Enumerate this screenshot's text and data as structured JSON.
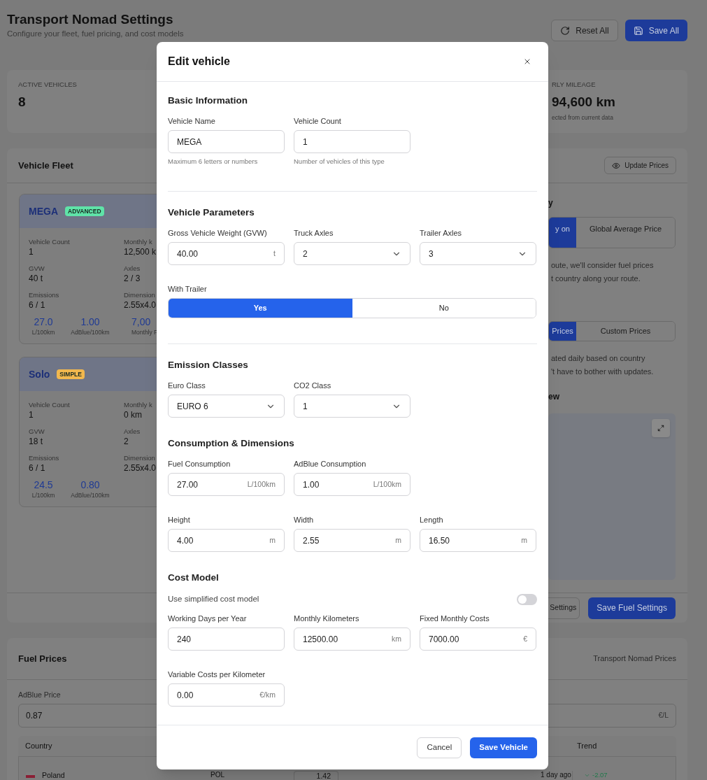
{
  "header": {
    "title": "Transport Nomad Settings",
    "subtitle": "Configure your fleet, fuel pricing, and cost models",
    "buttons": [
      {
        "label": "Reset All",
        "kind": "secondary"
      },
      {
        "label": "Save All",
        "kind": "primary"
      }
    ]
  },
  "stats": {
    "left": {
      "label": "ACTIVE VEHICLES",
      "value": "8"
    },
    "right": {
      "label": "RLY MILEAGE",
      "value": "94,600 km",
      "note": "ected from current data"
    }
  },
  "vehicle_fleet": {
    "title": "Vehicle Fleet",
    "action": "Update Prices",
    "vehicles": [
      {
        "name": "MEGA",
        "badge": "ADVANCED",
        "color": "#5fe3a8",
        "fields": [
          {
            "label": "Vehicle Count",
            "value": "1"
          },
          {
            "label": "Monthly k",
            "value": "12,500 k"
          },
          {
            "label": "GVW",
            "value": "40 t"
          },
          {
            "label": "Axles",
            "value": "2 / 3"
          },
          {
            "label": "Emissions",
            "value": "6 / 1"
          },
          {
            "label": "Dimension",
            "value": "2.55x4.0"
          }
        ],
        "metrics": [
          {
            "value": "27.0",
            "label": "L/100km"
          },
          {
            "value": "1.00",
            "label": "AdBlue/100km"
          },
          {
            "value": "7,00",
            "label": "Monthly F"
          }
        ]
      },
      {
        "name": "Solo",
        "badge": "SIMPLE",
        "color": "#f2b84e",
        "fields": [
          {
            "label": "Vehicle Count",
            "value": "1"
          },
          {
            "label": "Monthly k",
            "value": "0 km"
          },
          {
            "label": "GVW",
            "value": "18 t"
          },
          {
            "label": "Axles",
            "value": "2"
          },
          {
            "label": "Emissions",
            "value": "6 / 1"
          },
          {
            "label": "Dimension",
            "value": "2.55x4.0"
          }
        ],
        "metrics": [
          {
            "value": "24.5",
            "label": "L/100km"
          },
          {
            "value": "0.80",
            "label": "AdBlue/100km"
          }
        ]
      }
    ],
    "fuel_strategy": {
      "title": "y",
      "options": [
        {
          "label": "y on",
          "selected": true
        },
        {
          "label": "Global Average Price",
          "selected": false
        }
      ],
      "note": "oute, we'll consider fuel prices\nt country along your route.",
      "price_options": [
        {
          "label": "Prices",
          "selected": true
        },
        {
          "label": "Custom Prices",
          "selected": false
        }
      ],
      "price_note": "ated daily based on country\n't have to bother with updates.",
      "map_title": "ew"
    },
    "footer_buttons": [
      {
        "label": "Settings",
        "kind": "secondary"
      },
      {
        "label": "Save Fuel Settings",
        "kind": "primary"
      }
    ]
  },
  "fuel_prices": {
    "title": "Fuel Prices",
    "source": "Transport Nomad Prices",
    "adblue_label": "AdBlue Price",
    "adblue_value": "0.87",
    "adblue_unit": "€/L",
    "table": {
      "columns": [
        "Country",
        "Trend"
      ],
      "rows": [
        {
          "country": "Poland",
          "code": "POL",
          "price": "1.42",
          "updated": "1 day ago",
          "trend": "-2.07"
        }
      ]
    }
  },
  "modal": {
    "title": "Edit vehicle",
    "sections": [
      {
        "title": "Basic Information",
        "divider_after": true,
        "rows": [
          {
            "kind": "fields",
            "fields": [
              {
                "kind": "input",
                "label": "Vehicle Name",
                "value": "MEGA",
                "hint": "Maximum 6 letters or numbers"
              },
              {
                "kind": "input",
                "label": "Vehicle Count",
                "value": "1",
                "hint": "Number of vehicles of this type"
              }
            ]
          }
        ]
      },
      {
        "title": "Vehicle Parameters",
        "divider_after": true,
        "rows": [
          {
            "kind": "fields",
            "fields": [
              {
                "kind": "input",
                "label": "Gross Vehicle Weight (GVW)",
                "value": "40.00",
                "unit": "t"
              },
              {
                "kind": "select",
                "label": "Truck Axles",
                "value": "2"
              },
              {
                "kind": "select",
                "label": "Trailer Axles",
                "value": "3"
              }
            ]
          },
          {
            "kind": "fields",
            "fields": [
              {
                "kind": "segmented",
                "label": "With Trailer",
                "options": [
                  {
                    "label": "Yes",
                    "selected": true
                  },
                  {
                    "label": "No",
                    "selected": false
                  }
                ]
              }
            ]
          }
        ]
      },
      {
        "title": "Emission Classes",
        "divider_after": false,
        "rows": [
          {
            "kind": "fields",
            "fields": [
              {
                "kind": "select",
                "label": "Euro Class",
                "value": "EURO 6"
              },
              {
                "kind": "select",
                "label": "CO2 Class",
                "value": "1"
              }
            ]
          }
        ]
      },
      {
        "title": "Consumption & Dimensions",
        "divider_after": false,
        "rows": [
          {
            "kind": "fields",
            "fields": [
              {
                "kind": "input",
                "label": "Fuel Consumption",
                "value": "27.00",
                "unit": "L/100km"
              },
              {
                "kind": "input",
                "label": "AdBlue Consumption",
                "value": "1.00",
                "unit": "L/100km"
              }
            ]
          },
          {
            "kind": "fields",
            "fields": [
              {
                "kind": "input",
                "label": "Height",
                "value": "4.00",
                "unit": "m"
              },
              {
                "kind": "input",
                "label": "Width",
                "value": "2.55",
                "unit": "m"
              },
              {
                "kind": "input",
                "label": "Length",
                "value": "16.50",
                "unit": "m"
              }
            ]
          }
        ]
      },
      {
        "title": "Cost Model",
        "divider_after": false,
        "rows": [
          {
            "kind": "switch",
            "label": "Use simplified cost model",
            "on": false
          },
          {
            "kind": "fields",
            "fields": [
              {
                "kind": "input",
                "label": "Working Days per Year",
                "value": "240"
              },
              {
                "kind": "input",
                "label": "Monthly Kilometers",
                "value": "12500.00",
                "unit": "km"
              },
              {
                "kind": "input",
                "label": "Fixed Monthly Costs",
                "value": "7000.00",
                "unit": "€"
              }
            ]
          },
          {
            "kind": "fields",
            "fields": [
              {
                "kind": "input",
                "label": "Variable Costs per Kilometer",
                "value": "0.00",
                "unit": "€/km"
              }
            ]
          }
        ]
      }
    ],
    "buttons": [
      {
        "label": "Cancel",
        "kind": "secondary"
      },
      {
        "label": "Save Vehicle",
        "kind": "primary"
      }
    ]
  }
}
